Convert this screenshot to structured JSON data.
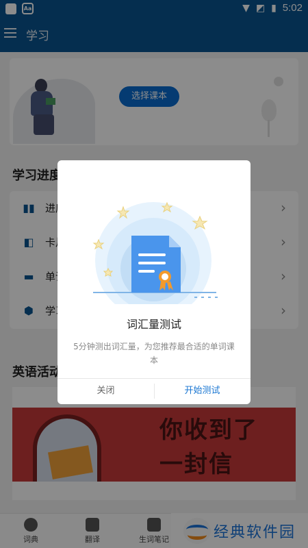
{
  "status_bar": {
    "time": "5:02",
    "dict_badge": "Aa"
  },
  "app_bar": {
    "title": "学习"
  },
  "course_card": {
    "choose_button": "选择课本"
  },
  "progress_section": {
    "title": "学习进度",
    "items": [
      {
        "label": "进度",
        "icon": "bar-chart-icon"
      },
      {
        "label": "卡片",
        "icon": "cards-icon"
      },
      {
        "label": "单词",
        "icon": "wordbook-icon"
      },
      {
        "label": "学习",
        "icon": "hexagon-icon"
      }
    ]
  },
  "activity_section": {
    "title": "英语活动",
    "banner_line1": "你收到了",
    "banner_line2": "一封信"
  },
  "bottom_nav": {
    "items": [
      {
        "label": "词典",
        "icon": "search-icon"
      },
      {
        "label": "翻译",
        "icon": "translate-icon"
      },
      {
        "label": "生词笔记",
        "icon": "notebook-icon"
      }
    ]
  },
  "watermark": {
    "text": "经典软件园"
  },
  "dialog": {
    "title": "词汇量测试",
    "description": "5分钟测出词汇量，为您推荐最合适的单词课本",
    "close_button": "关闭",
    "start_button": "开始测试"
  },
  "colors": {
    "primary": "#0a5591",
    "accent_blue": "#1976d2",
    "button_blue": "#0a6ccf",
    "banner_red": "#c73a3a"
  }
}
